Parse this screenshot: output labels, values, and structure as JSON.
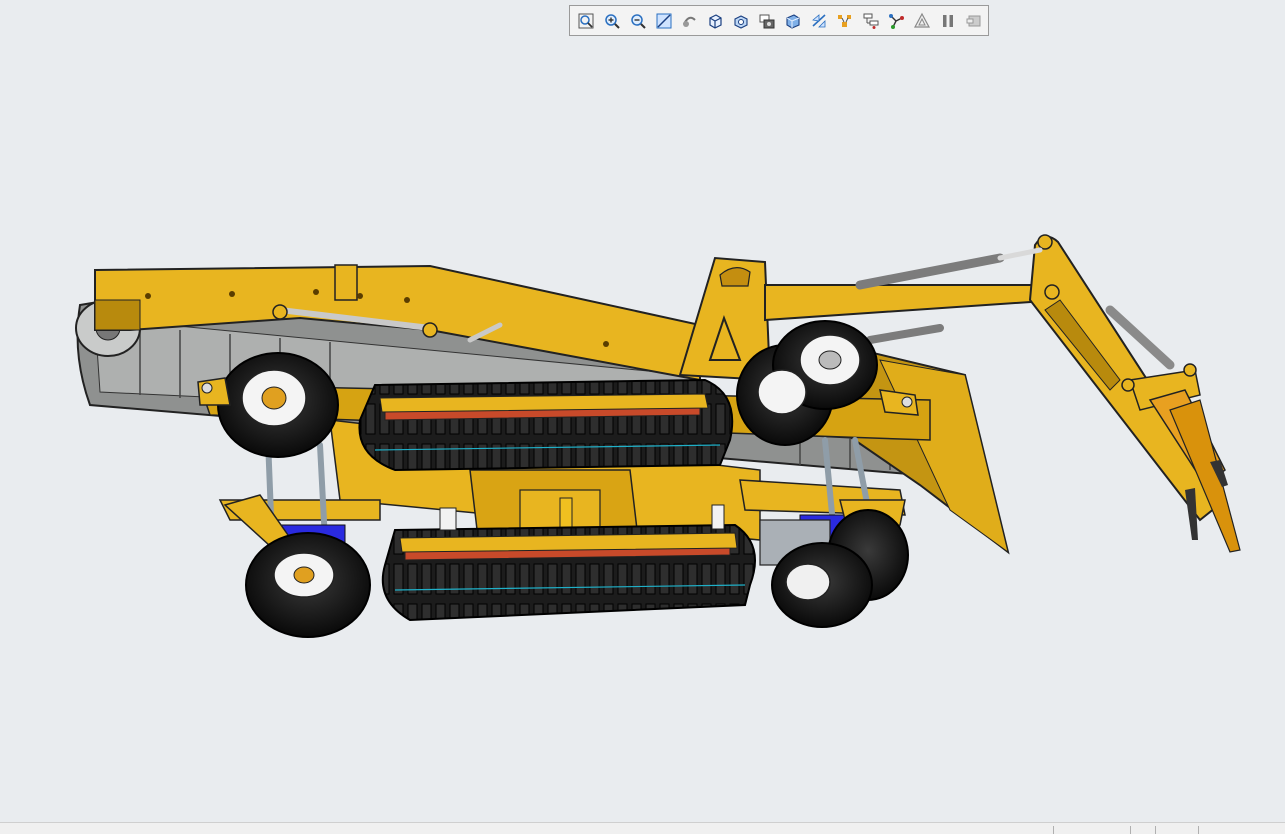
{
  "app": {
    "kind": "3D CAD viewer",
    "colors": {
      "background": "#e9ecef",
      "body": "#e8b520",
      "body_dark": "#b88a0d",
      "track": "#1c1c1c",
      "tire": "#0d0d0d",
      "hydraulic": "#b9b9b9",
      "accent_blue": "#2a2ae0"
    }
  },
  "toolbar": {
    "buttons": [
      {
        "name": "zoom-fit-icon"
      },
      {
        "name": "zoom-in-icon"
      },
      {
        "name": "zoom-out-icon"
      },
      {
        "name": "zoom-area-icon"
      },
      {
        "name": "rotate-view-icon"
      },
      {
        "name": "view-cube-icon"
      },
      {
        "name": "view-orientation-icon"
      },
      {
        "name": "camera-capture-icon"
      },
      {
        "name": "display-style-icon"
      },
      {
        "name": "section-view-icon"
      },
      {
        "name": "explode-icon"
      },
      {
        "name": "tree-view-icon"
      },
      {
        "name": "connections-icon"
      },
      {
        "name": "measure-icon"
      },
      {
        "name": "pause-icon"
      },
      {
        "name": "exit-view-icon"
      }
    ]
  },
  "model": {
    "description_icon": "tracked-excavator-model"
  }
}
